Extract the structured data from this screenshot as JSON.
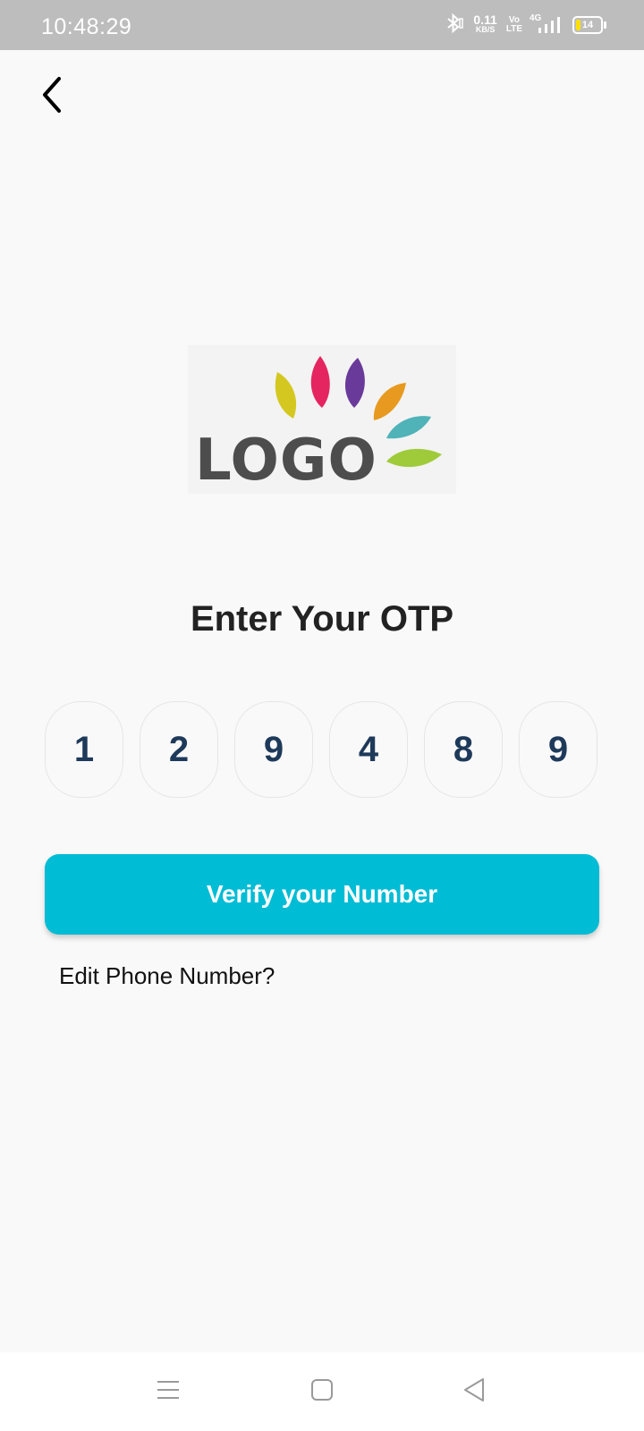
{
  "status_bar": {
    "time": "10:48:29",
    "net_speed_value": "0.11",
    "net_speed_unit": "KB/S",
    "volte_top": "Vo",
    "volte_bottom": "LTE",
    "network_type": "4G",
    "battery_level": "14",
    "icons": [
      "bluetooth-icon",
      "signal-icon",
      "battery-icon"
    ]
  },
  "header": {
    "back_icon": "chevron-left-icon"
  },
  "logo": {
    "text": "LOGO",
    "leaf_colors": [
      "#d4c820",
      "#e5255f",
      "#6a3a9a",
      "#e79a1f",
      "#4fb3b8",
      "#9fcb3b"
    ]
  },
  "main": {
    "title": "Enter Your OTP",
    "otp_digits": [
      "1",
      "2",
      "9",
      "4",
      "8",
      "9"
    ],
    "verify_label": "Verify your Number",
    "edit_phone_label": "Edit Phone Number?"
  },
  "nav_bar": {
    "items": [
      "menu-icon",
      "home-square-icon",
      "back-triangle-icon"
    ]
  },
  "colors": {
    "accent": "#00bcd4",
    "status_bar": "#bdbdbd",
    "otp_digit": "#1e3a5a",
    "background": "#f9f9f9"
  }
}
